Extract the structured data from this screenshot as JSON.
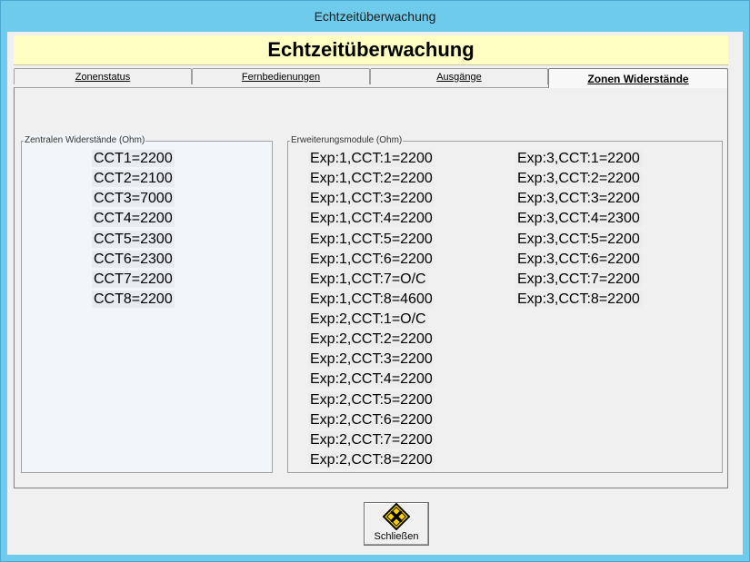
{
  "window": {
    "title": "Echtzeitüberwachung"
  },
  "banner": {
    "title": "Echtzeitüberwachung"
  },
  "tabs": [
    {
      "label": "Zonenstatus"
    },
    {
      "label": "Fernbedienungen"
    },
    {
      "label": "Ausgänge"
    },
    {
      "label": "Zonen Widerstände",
      "active": true
    }
  ],
  "central": {
    "legend": "Zentralen Widerstände (Ohm)",
    "items": [
      "CCT1=2200",
      "CCT2=2100",
      "CCT3=7000",
      "CCT4=2200",
      "CCT5=2300",
      "CCT6=2300",
      "CCT7=2200",
      "CCT8=2200"
    ]
  },
  "expansion": {
    "legend": "Erweiterungsmodule (Ohm)",
    "col1": [
      "Exp:1,CCT:1=2200",
      "Exp:1,CCT:2=2200",
      "Exp:1,CCT:3=2200",
      "Exp:1,CCT:4=2200",
      "Exp:1,CCT:5=2200",
      "Exp:1,CCT:6=2200",
      "Exp:1,CCT:7=O/C",
      "Exp:1,CCT:8=4600",
      "Exp:2,CCT:1=O/C",
      "Exp:2,CCT:2=2200",
      "Exp:2,CCT:3=2200",
      "Exp:2,CCT:4=2200",
      "Exp:2,CCT:5=2200",
      "Exp:2,CCT:6=2200",
      "Exp:2,CCT:7=2200",
      "Exp:2,CCT:8=2200"
    ],
    "col2": [
      "Exp:3,CCT:1=2200",
      "Exp:3,CCT:2=2200",
      "Exp:3,CCT:3=2200",
      "Exp:3,CCT:4=2300",
      "Exp:3,CCT:5=2200",
      "Exp:3,CCT:6=2200",
      "Exp:3,CCT:7=2200",
      "Exp:3,CCT:8=2200"
    ]
  },
  "close_button": {
    "label": "Schließen",
    "icon": "warning-close-icon"
  },
  "colors": {
    "titlebar": "#6fcbeb",
    "banner": "#ffffc4",
    "warning": "#f7d000"
  }
}
